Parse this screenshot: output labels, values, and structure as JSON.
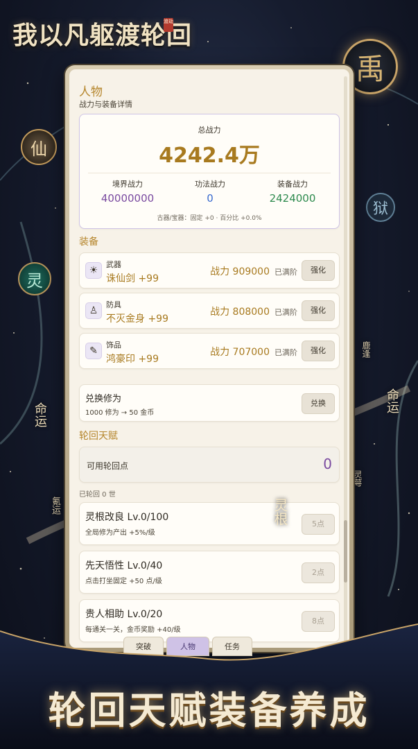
{
  "title": "我以凡躯渡轮回",
  "title_seal": "渡劫",
  "seals": {
    "top_right": "禹",
    "right": "狱",
    "left_upper": "仙",
    "left_lower": "灵"
  },
  "side_texts": [
    "命运",
    "氪运",
    "命运",
    "鹿逢",
    "灵萼",
    "灵根"
  ],
  "section_character": {
    "title": "人物",
    "subtitle": "战力与装备详情"
  },
  "power": {
    "label": "总战力",
    "total": "4242.4万",
    "stats": [
      {
        "label": "境界战力",
        "value": "40000000"
      },
      {
        "label": "功法战力",
        "value": "0"
      },
      {
        "label": "装备战力",
        "value": "2424000"
      }
    ],
    "note": "古器/宝器：固定 +0 · 百分比 +0.0%"
  },
  "section_equipment": "装备",
  "equipment": [
    {
      "type": "武器",
      "name": "诛仙剑 +99",
      "power": "战力 909000",
      "status": "已满阶",
      "button": "强化",
      "icon": "sun-icon"
    },
    {
      "type": "防具",
      "name": "不灭金身 +99",
      "power": "战力 808000",
      "status": "已满阶",
      "button": "强化",
      "icon": "buddha-icon"
    },
    {
      "type": "饰品",
      "name": "鸿豪印 +99",
      "power": "战力 707000",
      "status": "已满阶",
      "button": "强化",
      "icon": "brush-icon"
    }
  ],
  "exchange": {
    "title": "兑换修为",
    "desc": "1000 修为 → 50 金币",
    "button": "兑换"
  },
  "section_talent": "轮回天赋",
  "points": {
    "label": "可用轮回点",
    "value": "0"
  },
  "reincarnation": "已轮回 0 世",
  "talents": [
    {
      "title": "灵根改良  Lv.0/100",
      "desc": "全局修为产出 +5%/级",
      "button": "5点"
    },
    {
      "title": "先天悟性  Lv.0/40",
      "desc": "点击打坐固定 +50 点/级",
      "button": "2点"
    },
    {
      "title": "贵人相助  Lv.0/20",
      "desc": "每通关一关，金币奖励 +40/级",
      "button": "8点"
    }
  ],
  "tabs": [
    "突破",
    "人物",
    "任务"
  ],
  "banner": "轮回天赋装备养成"
}
